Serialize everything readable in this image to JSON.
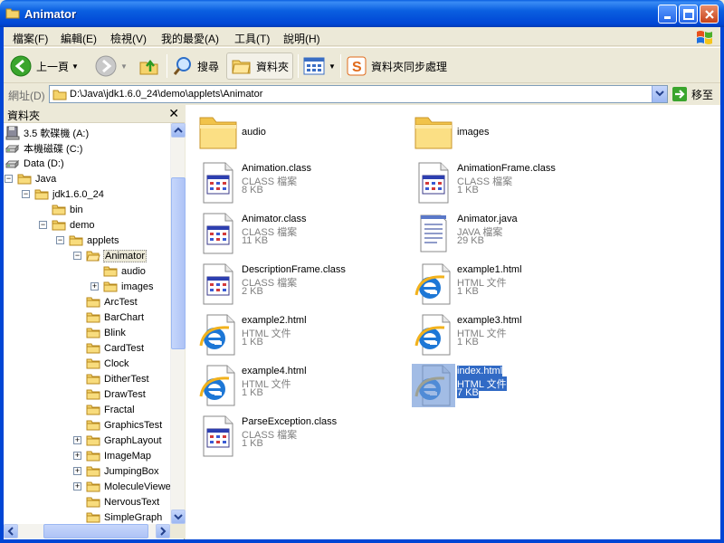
{
  "window": {
    "title": "Animator"
  },
  "menu": [
    "檔案(F)",
    "編輯(E)",
    "檢視(V)",
    "我的最愛(A)",
    "工具(T)",
    "說明(H)"
  ],
  "toolbar": {
    "back": "上一頁",
    "search": "搜尋",
    "folders": "資料夾",
    "sync": "資料夾同步處理"
  },
  "address": {
    "label": "網址(D)",
    "path": "D:\\Java\\jdk1.6.0_24\\demo\\applets\\Animator",
    "go": "移至"
  },
  "folder_pane": {
    "title": "資料夾",
    "tree": [
      {
        "label": "3.5 軟碟機 (A:)",
        "icon": "floppy-icon",
        "depth": 0
      },
      {
        "label": "本機磁碟 (C:)",
        "icon": "drive-icon",
        "depth": 0
      },
      {
        "label": "Data (D:)",
        "icon": "drive-icon",
        "depth": 0
      },
      {
        "label": "Java",
        "icon": "folder-icon",
        "depth": 1,
        "expander": "minus"
      },
      {
        "label": "jdk1.6.0_24",
        "icon": "folder-icon",
        "depth": 2,
        "expander": "minus"
      },
      {
        "label": "bin",
        "icon": "folder-icon",
        "depth": 3
      },
      {
        "label": "demo",
        "icon": "folder-icon",
        "depth": 3,
        "expander": "minus"
      },
      {
        "label": "applets",
        "icon": "folder-icon",
        "depth": 4,
        "expander": "minus"
      },
      {
        "label": "Animator",
        "icon": "folder-open-icon",
        "depth": 5,
        "expander": "minus",
        "selected": true
      },
      {
        "label": "audio",
        "icon": "folder-icon",
        "depth": 6
      },
      {
        "label": "images",
        "icon": "folder-icon",
        "depth": 6,
        "expander": "plus"
      },
      {
        "label": "ArcTest",
        "icon": "folder-icon",
        "depth": 5
      },
      {
        "label": "BarChart",
        "icon": "folder-icon",
        "depth": 5
      },
      {
        "label": "Blink",
        "icon": "folder-icon",
        "depth": 5
      },
      {
        "label": "CardTest",
        "icon": "folder-icon",
        "depth": 5
      },
      {
        "label": "Clock",
        "icon": "folder-icon",
        "depth": 5
      },
      {
        "label": "DitherTest",
        "icon": "folder-icon",
        "depth": 5
      },
      {
        "label": "DrawTest",
        "icon": "folder-icon",
        "depth": 5
      },
      {
        "label": "Fractal",
        "icon": "folder-icon",
        "depth": 5
      },
      {
        "label": "GraphicsTest",
        "icon": "folder-icon",
        "depth": 5
      },
      {
        "label": "GraphLayout",
        "icon": "folder-icon",
        "depth": 5,
        "expander": "plus"
      },
      {
        "label": "ImageMap",
        "icon": "folder-icon",
        "depth": 5,
        "expander": "plus"
      },
      {
        "label": "JumpingBox",
        "icon": "folder-icon",
        "depth": 5,
        "expander": "plus"
      },
      {
        "label": "MoleculeViewer",
        "icon": "folder-icon",
        "depth": 5,
        "expander": "plus"
      },
      {
        "label": "NervousText",
        "icon": "folder-icon",
        "depth": 5
      },
      {
        "label": "SimpleGraph",
        "icon": "folder-icon",
        "depth": 5
      }
    ]
  },
  "files": [
    {
      "name": "audio",
      "type": "",
      "size": "",
      "icon": "folder-icon"
    },
    {
      "name": "images",
      "type": "",
      "size": "",
      "icon": "folder-icon"
    },
    {
      "name": "Animation.class",
      "type": "CLASS 檔案",
      "size": "8 KB",
      "icon": "class-file-icon"
    },
    {
      "name": "AnimationFrame.class",
      "type": "CLASS 檔案",
      "size": "1 KB",
      "icon": "class-file-icon"
    },
    {
      "name": "Animator.class",
      "type": "CLASS 檔案",
      "size": "11 KB",
      "icon": "class-file-icon"
    },
    {
      "name": "Animator.java",
      "type": "JAVA 檔案",
      "size": "29 KB",
      "icon": "text-file-icon"
    },
    {
      "name": "DescriptionFrame.class",
      "type": "CLASS 檔案",
      "size": "2 KB",
      "icon": "class-file-icon"
    },
    {
      "name": "example1.html",
      "type": "HTML 文件",
      "size": "1 KB",
      "icon": "ie-html-icon"
    },
    {
      "name": "example2.html",
      "type": "HTML 文件",
      "size": "1 KB",
      "icon": "ie-html-icon"
    },
    {
      "name": "example3.html",
      "type": "HTML 文件",
      "size": "1 KB",
      "icon": "ie-html-icon"
    },
    {
      "name": "example4.html",
      "type": "HTML 文件",
      "size": "1 KB",
      "icon": "ie-html-icon"
    },
    {
      "name": "index.html",
      "type": "HTML 文件",
      "size": "7 KB",
      "icon": "ie-html-icon",
      "selected": true
    },
    {
      "name": "ParseException.class",
      "type": "CLASS 檔案",
      "size": "1 KB",
      "icon": "class-file-icon"
    }
  ]
}
